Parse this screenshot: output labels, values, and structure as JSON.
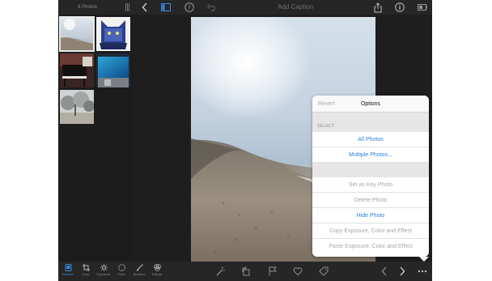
{
  "topbar": {
    "photos_count": "6 Photos",
    "caption_placeholder": "Add Caption",
    "icons": [
      "grip-icon",
      "back-chevron-icon",
      "sidebar-toggle-icon",
      "help-icon",
      "undo-icon",
      "share-icon",
      "info-icon",
      "battery-icon"
    ]
  },
  "sidebar": {
    "thumbnails": [
      {
        "name": "beach",
        "selected": true
      },
      {
        "name": "cat",
        "selected": false
      },
      {
        "name": "piano",
        "selected": false
      },
      {
        "name": "aquarium",
        "selected": false
      },
      {
        "name": "trees",
        "selected": false
      }
    ]
  },
  "toolbar": {
    "tools": [
      {
        "label": "Browse",
        "icon": "browse-icon",
        "active": true
      },
      {
        "label": "Crop",
        "icon": "crop-icon",
        "active": false
      },
      {
        "label": "Exposure",
        "icon": "exposure-icon",
        "active": false
      },
      {
        "label": "Color",
        "icon": "color-icon",
        "active": false
      },
      {
        "label": "Brushes",
        "icon": "brush-icon",
        "active": false
      },
      {
        "label": "Effects",
        "icon": "effects-icon",
        "active": false
      }
    ],
    "center_icons": [
      "auto-enhance-icon",
      "rotate-icon",
      "flag-icon",
      "heart-icon",
      "tag-icon"
    ],
    "right_icons": [
      "previous-chevron-icon",
      "next-chevron-icon",
      "more-icon"
    ]
  },
  "popover": {
    "revert_label": "Revert",
    "title": "Options",
    "section_label": "SELECT",
    "items": [
      {
        "label": "All Photos",
        "enabled": true
      },
      {
        "label": "Multiple Photos...",
        "enabled": true
      },
      {
        "label": "Set as Key Photo",
        "enabled": false
      },
      {
        "label": "Delete Photo",
        "enabled": false
      },
      {
        "label": "Hide Photo",
        "enabled": true
      },
      {
        "label": "Copy Exposure, Color and Effect",
        "enabled": false
      },
      {
        "label": "Paste Exposure, Color and Effect",
        "enabled": false
      }
    ]
  },
  "colors": {
    "accent": "#2f7fe0",
    "app_background": "#1b1b1b",
    "bar_background": "#262626",
    "popover_background": "#f7f7f7"
  }
}
